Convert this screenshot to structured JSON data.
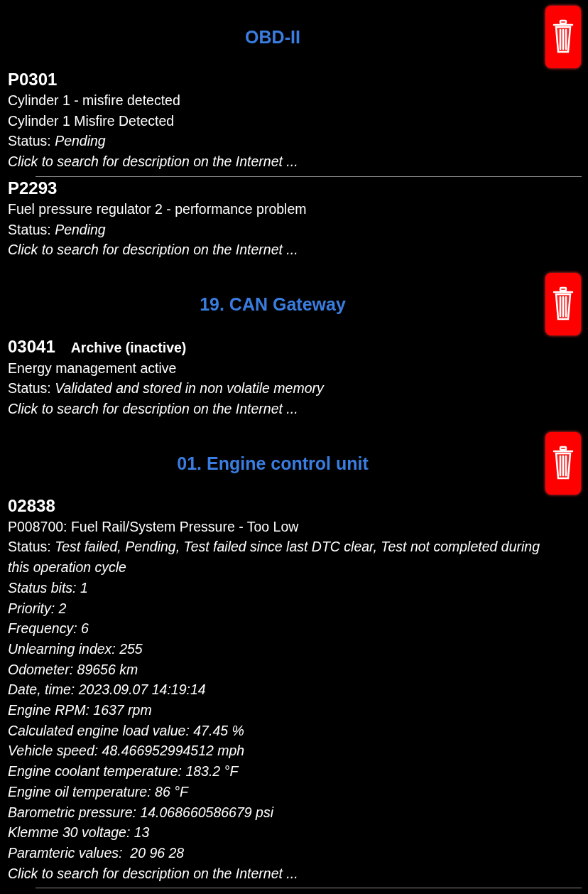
{
  "sections": [
    {
      "title": "OBD-II",
      "codes": [
        {
          "code": "P0301",
          "descriptions": [
            "Cylinder 1 - misfire detected",
            "Cylinder 1 Misfire Detected"
          ],
          "status_label": "Status:",
          "status": "Pending",
          "link": "Click to search for description on the Internet ..."
        },
        {
          "code": "P2293",
          "descriptions": [
            "Fuel pressure regulator 2 - performance problem"
          ],
          "status_label": "Status:",
          "status": "Pending",
          "link": "Click to search for description on the Internet ..."
        }
      ]
    },
    {
      "title": "19. CAN Gateway",
      "codes": [
        {
          "code": "03041",
          "tag": "Archive (inactive)",
          "descriptions": [
            "Energy management active"
          ],
          "status_label": "Status:",
          "status": "Validated and stored in non volatile memory",
          "link": "Click to search for description on the Internet ..."
        }
      ]
    },
    {
      "title": "01. Engine control unit",
      "codes": [
        {
          "code": "02838",
          "descriptions": [
            "P008700: Fuel Rail/System Pressure - Too Low"
          ],
          "status_label": "Status:",
          "status": "Test failed, Pending, Test failed since last DTC clear, Test not completed during this operation cycle",
          "details": [
            "Status bits: 1",
            "Priority: 2",
            "Frequency: 6",
            "Unlearning index: 255",
            "Odometer: 89656 km",
            "Date, time: 2023.09.07 14:19:14",
            "Engine RPM: 1637 rpm",
            "Calculated engine load value: 47.45 %",
            "Vehicle speed: 48.466952994512 mph",
            "Engine coolant temperature: 183.2 °F",
            "Engine oil temperature: 86 °F",
            "Barometric pressure: 14.068660586679 psi",
            "Klemme 30 voltage: 13",
            "Paramteric values:  20 96 28"
          ],
          "link": "Click to search for description on the Internet ..."
        }
      ]
    }
  ]
}
